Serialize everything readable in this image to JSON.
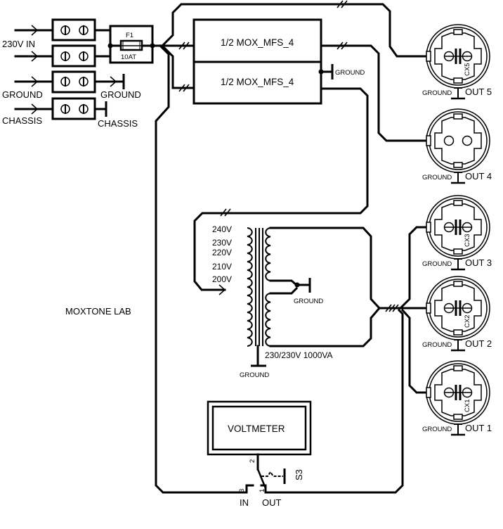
{
  "title": "MOXTONE LAB",
  "inputs": {
    "mains_label": "230V IN",
    "ground_in_label": "GROUND",
    "ground_out_label": "GROUND",
    "chassis_in_label": "CHASSIS",
    "chassis_out_label": "CHASSIS"
  },
  "fuse": {
    "ref": "F1",
    "rating": "10AT"
  },
  "filters": [
    {
      "label": "1/2 MOX_MFS_4"
    },
    {
      "label": "1/2 MOX_MFS_4"
    }
  ],
  "filter_ground_label": "GROUND",
  "transformer": {
    "taps": [
      "240V",
      "230V",
      "220V",
      "210V",
      "200V"
    ],
    "rating": "230/230V 1000VA",
    "center_tap_ground": "GROUND",
    "core_ground": "GROUND"
  },
  "outlets": [
    {
      "name": "OUT 5",
      "cap": "CX5",
      "ground": "GROUND",
      "has_cap": true
    },
    {
      "name": "OUT 4",
      "cap": "",
      "ground": "GROUND",
      "has_cap": false
    },
    {
      "name": "OUT 3",
      "cap": "CX3",
      "ground": "GROUND",
      "has_cap": true
    },
    {
      "name": "OUT 2",
      "cap": "CX2",
      "ground": "GROUND",
      "has_cap": true
    },
    {
      "name": "OUT 1",
      "cap": "CX1",
      "ground": "GROUND",
      "has_cap": true
    }
  ],
  "voltmeter": {
    "label": "VOLTMETER"
  },
  "switch": {
    "ref": "S3",
    "pin1": "1",
    "pin2": "2",
    "pin3": "3",
    "in_label": "IN",
    "out_label": "OUT"
  }
}
